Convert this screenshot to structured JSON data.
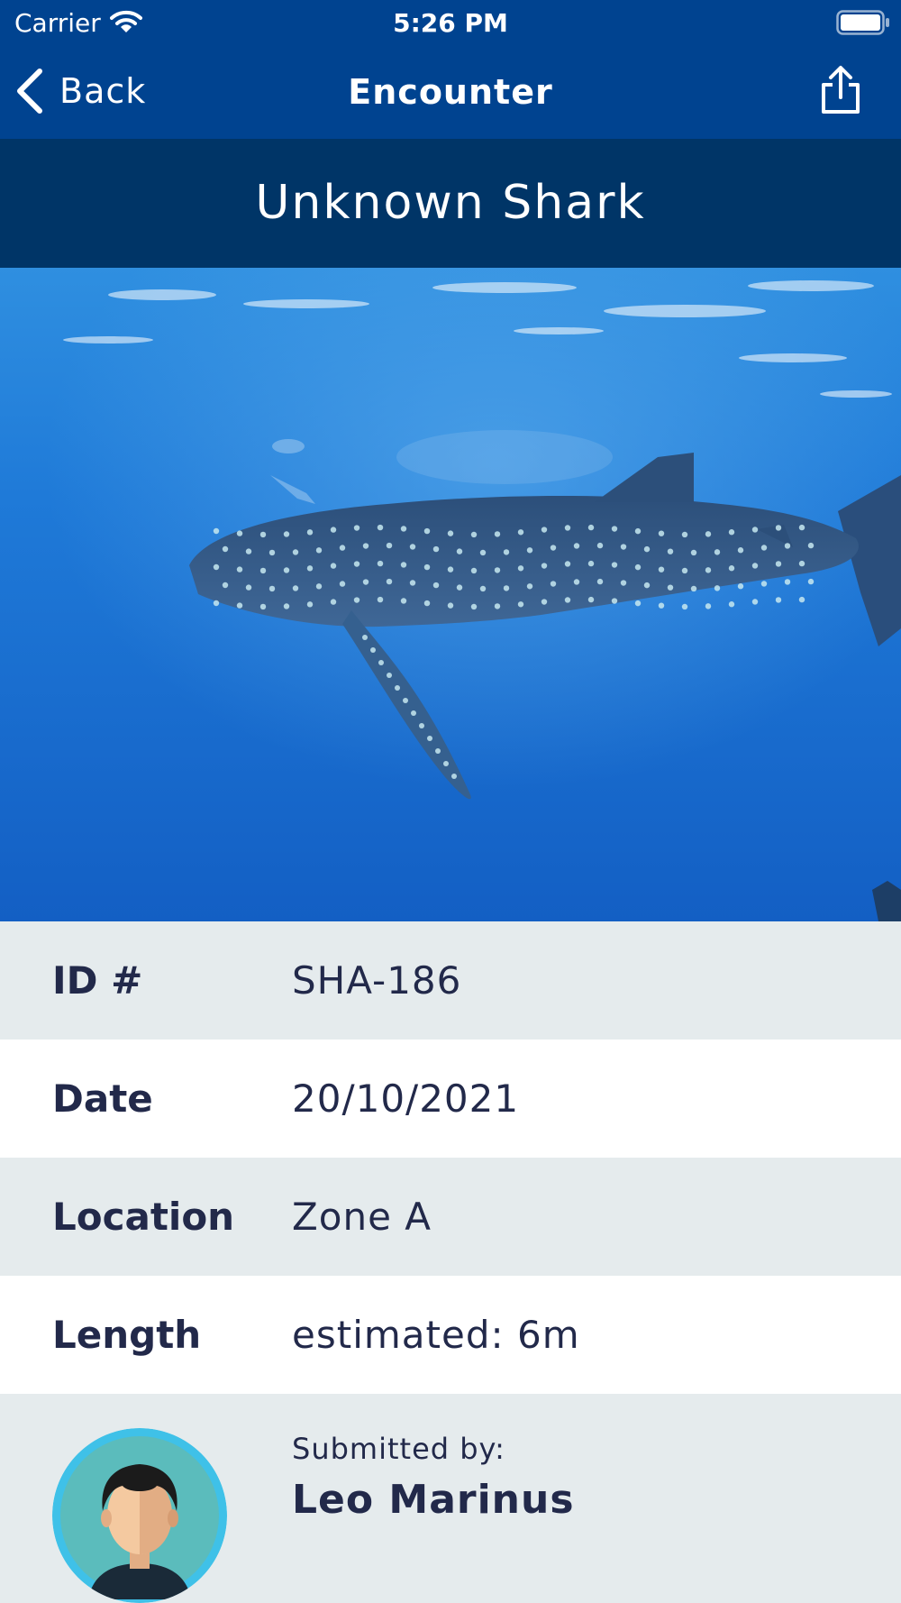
{
  "status_bar": {
    "carrier": "Carrier",
    "time": "5:26 PM",
    "wifi_icon": "wifi-icon",
    "battery_icon": "battery-icon"
  },
  "nav": {
    "back_label": "Back",
    "title": "Encounter",
    "back_icon": "chevron-left-icon",
    "share_icon": "share-icon"
  },
  "species": "Unknown Shark",
  "photo": {
    "subject": "whale-shark-photo"
  },
  "details": [
    {
      "label": "ID #",
      "value": "SHA-186"
    },
    {
      "label": "Date",
      "value": "20/10/2021"
    },
    {
      "label": "Location",
      "value": "Zone A"
    },
    {
      "label": "Length",
      "value": "estimated: 6m"
    }
  ],
  "submitter": {
    "label": "Submitted by:",
    "name": "Leo Marinus"
  },
  "colors": {
    "nav_bg": "#004390",
    "banner_bg": "#003567",
    "row_shade": "#e5ebed",
    "row_white": "#ffffff",
    "text": "#22294a",
    "avatar_ring": "#3fc1e8",
    "avatar_bg": "#5bbcbc"
  }
}
